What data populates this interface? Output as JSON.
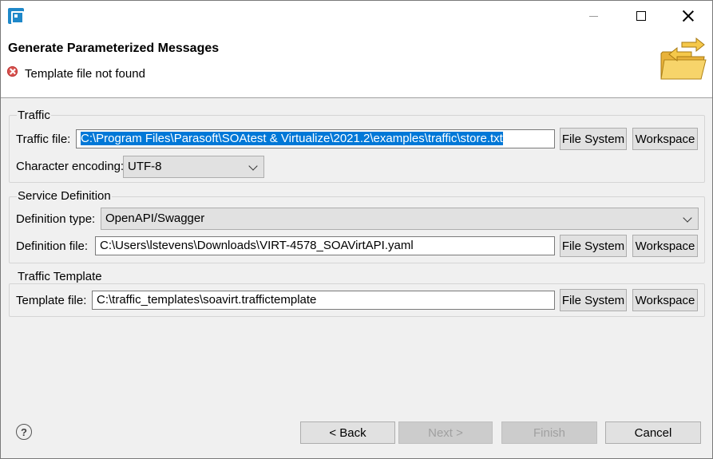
{
  "window": {
    "title": ""
  },
  "header": {
    "title": "Generate Parameterized Messages",
    "error_message": "Template file not found"
  },
  "traffic": {
    "legend": "Traffic",
    "file_label": "Traffic file:",
    "file_value": "C:\\Program Files\\Parasoft\\SOAtest & Virtualize\\2021.2\\examples\\traffic\\store.txt",
    "encoding_label": "Character encoding:",
    "encoding_value": "UTF-8",
    "file_system_label": "File System",
    "workspace_label": "Workspace"
  },
  "service": {
    "legend": "Service Definition",
    "type_label": "Definition type:",
    "type_value": "OpenAPI/Swagger",
    "file_label": "Definition file:",
    "file_value": "C:\\Users\\lstevens\\Downloads\\VIRT-4578_SOAVirtAPI.yaml",
    "file_system_label": "File System",
    "workspace_label": "Workspace"
  },
  "template": {
    "legend": "Traffic Template",
    "file_label": "Template file:",
    "file_value": "C:\\traffic_templates\\soavirt.traffictemplate",
    "file_system_label": "File System",
    "workspace_label": "Workspace"
  },
  "footer": {
    "help_glyph": "?",
    "back_label": "< Back",
    "next_label": "Next >",
    "finish_label": "Finish",
    "cancel_label": "Cancel"
  },
  "colors": {
    "selection": "#0078d7",
    "error": "#d9534f",
    "button_face": "#e1e1e1"
  }
}
